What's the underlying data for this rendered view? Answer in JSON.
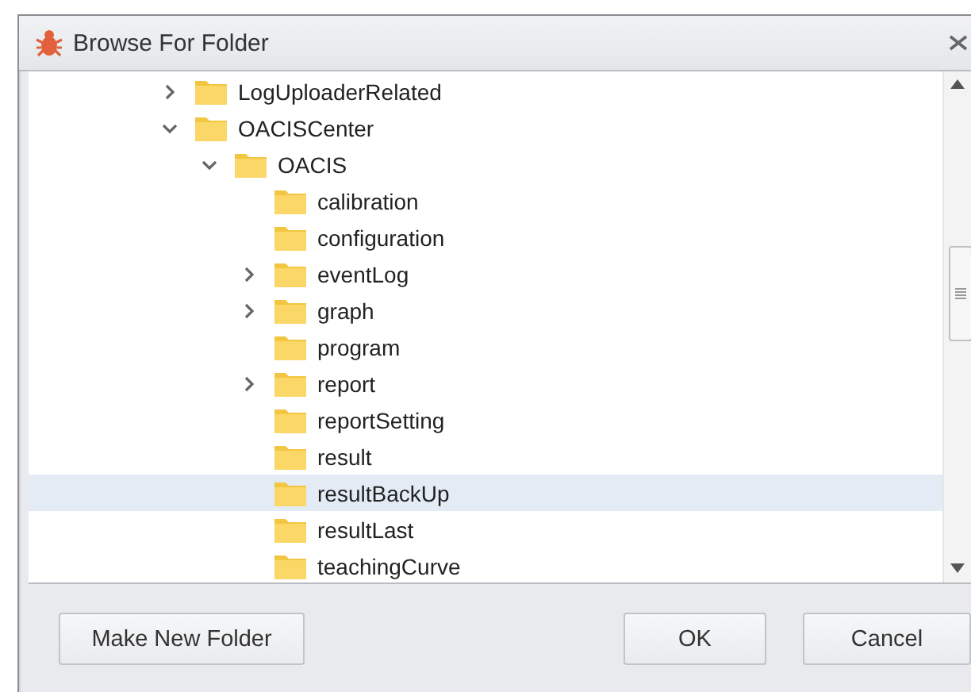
{
  "window": {
    "title": "Browse For Folder"
  },
  "tree": [
    {
      "label": "LogUploaderRelated",
      "expanded": false,
      "selected": false
    },
    {
      "label": "OACISCenter",
      "expanded": true,
      "selected": false,
      "children": [
        {
          "label": "OACIS",
          "expanded": true,
          "selected": false,
          "children": [
            {
              "label": "calibration",
              "selected": false
            },
            {
              "label": "configuration",
              "selected": false
            },
            {
              "label": "eventLog",
              "expanded": false,
              "selected": false
            },
            {
              "label": "graph",
              "expanded": false,
              "selected": false
            },
            {
              "label": "program",
              "selected": false
            },
            {
              "label": "report",
              "expanded": false,
              "selected": false
            },
            {
              "label": "reportSetting",
              "selected": false
            },
            {
              "label": "result",
              "selected": false
            },
            {
              "label": "resultBackUp",
              "selected": true
            },
            {
              "label": "resultLast",
              "selected": false
            },
            {
              "label": "teachingCurve",
              "selected": false
            }
          ]
        }
      ]
    }
  ],
  "buttons": {
    "left": [
      "Make New Folder"
    ],
    "right": [
      "OK",
      "Cancel"
    ]
  }
}
